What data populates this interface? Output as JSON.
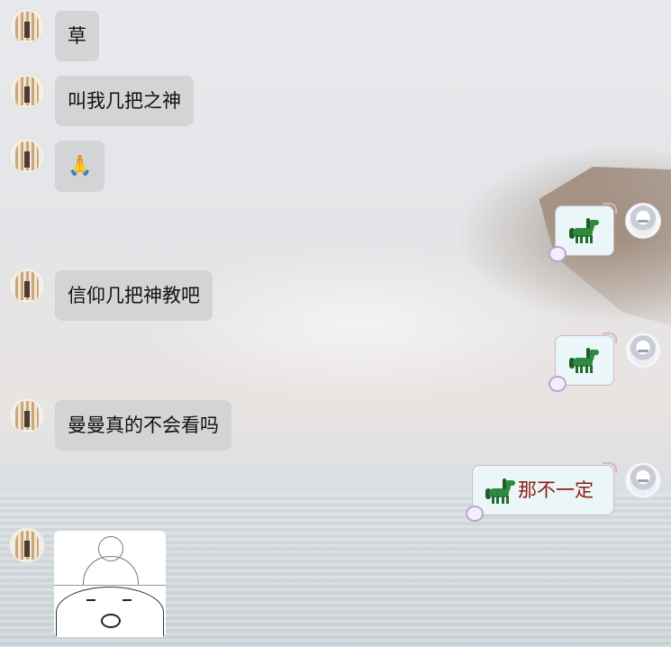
{
  "messages": [
    {
      "side": "left",
      "type": "text",
      "text": "草"
    },
    {
      "side": "left",
      "type": "text",
      "text": "叫我几把之神"
    },
    {
      "side": "left",
      "type": "emoji",
      "emoji": "🙏",
      "icon": "folded-hands-icon"
    },
    {
      "side": "right",
      "type": "sticker-horse",
      "icon": "green-horse-icon"
    },
    {
      "side": "left",
      "type": "text",
      "text": "信仰几把神教吧"
    },
    {
      "side": "right",
      "type": "sticker-horse",
      "icon": "green-horse-icon"
    },
    {
      "side": "left",
      "type": "text",
      "text": "曼曼真的不会看吗"
    },
    {
      "side": "right",
      "type": "horse-text",
      "icon": "green-horse-icon",
      "text": "那不一定"
    },
    {
      "side": "left",
      "type": "image",
      "icon": "meme-sticker-image"
    }
  ],
  "colors": {
    "left_bubble": "#d3d4d6",
    "right_bubble": "#eaf6f8",
    "right_text": "#8b1e12",
    "horse": "#2f8a3f"
  }
}
